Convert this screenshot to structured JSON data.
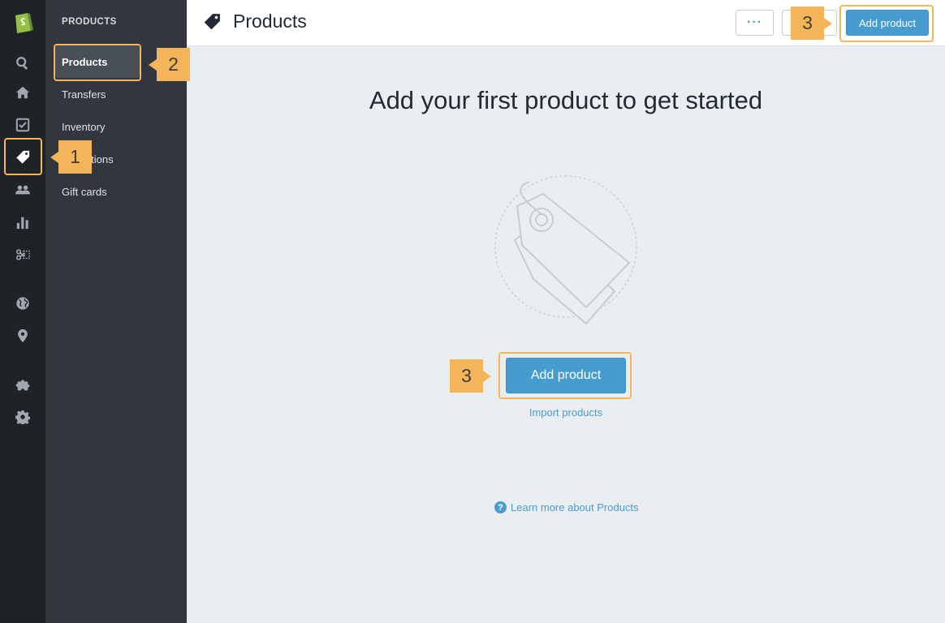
{
  "rail": {
    "items": [
      {
        "name": "search-icon"
      },
      {
        "name": "home-icon"
      },
      {
        "name": "orders-icon"
      },
      {
        "name": "tag-icon",
        "active": true
      },
      {
        "name": "customers-icon"
      },
      {
        "name": "reports-icon"
      },
      {
        "name": "discounts-icon"
      },
      {
        "name": "globe-icon"
      },
      {
        "name": "location-pin-icon"
      },
      {
        "name": "puzzle-icon"
      },
      {
        "name": "gear-icon"
      }
    ]
  },
  "subnav": {
    "heading": "PRODUCTS",
    "items": [
      {
        "label": "Products",
        "active": true
      },
      {
        "label": "Transfers"
      },
      {
        "label": "Inventory"
      },
      {
        "label": "Collections"
      },
      {
        "label": "Gift cards"
      }
    ]
  },
  "header": {
    "title": "Products",
    "more_label": "···",
    "add_label": "Add product"
  },
  "empty_state": {
    "title": "Add your first product to get started",
    "add_label": "Add product",
    "import_label": "Import products",
    "learn_more_label": "Learn more about Products",
    "help_icon_glyph": "?"
  },
  "callouts": {
    "one": "1",
    "two": "2",
    "three_header": "3",
    "three_main": "3"
  },
  "colors": {
    "accent": "#479ccf",
    "callout": "#f4b45a",
    "rail_bg": "#1f2226",
    "subnav_bg": "#31373d",
    "content_bg": "#ebeef0"
  }
}
